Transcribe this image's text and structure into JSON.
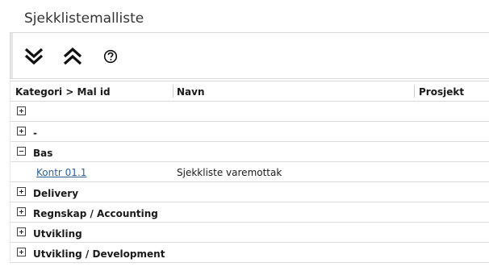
{
  "page": {
    "title": "Sjekklistemalliste"
  },
  "toolbar": {
    "buttons": [
      {
        "name": "expand-all-button",
        "icon": "double-chevron-down-icon"
      },
      {
        "name": "collapse-all-button",
        "icon": "double-chevron-up-icon"
      },
      {
        "name": "help-button",
        "icon": "help-icon"
      }
    ]
  },
  "table": {
    "columns": [
      "Kategori > Mal id",
      "Navn",
      "Prosjekt"
    ],
    "rows": [
      {
        "type": "group",
        "label": "",
        "expanded": false
      },
      {
        "type": "group",
        "label": "-",
        "expanded": false
      },
      {
        "type": "group",
        "label": "Bas",
        "expanded": true
      },
      {
        "type": "item",
        "id": "Kontr 01.1",
        "name": "Sjekkliste varemottak",
        "project": ""
      },
      {
        "type": "group",
        "label": "Delivery",
        "expanded": false
      },
      {
        "type": "group",
        "label": "Regnskap / Accounting",
        "expanded": false
      },
      {
        "type": "group",
        "label": "Utvikling",
        "expanded": false
      },
      {
        "type": "group",
        "label": "Utvikling / Development",
        "expanded": false
      }
    ]
  }
}
